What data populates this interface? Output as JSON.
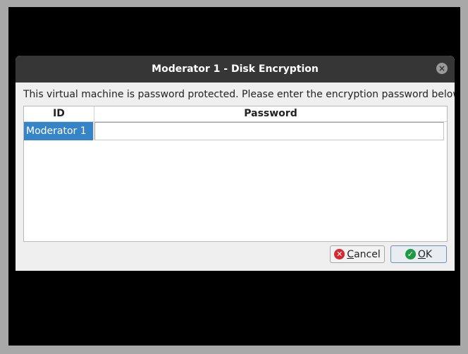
{
  "dialog": {
    "title": "Moderator 1 - Disk Encryption",
    "message": "This virtual machine is password protected. Please enter the encryption password below."
  },
  "table": {
    "columns": [
      "ID",
      "Password"
    ],
    "rows": [
      {
        "id": "Moderator 1",
        "password": ""
      }
    ]
  },
  "buttons": {
    "cancel": {
      "mnemonic": "C",
      "rest": "ancel",
      "icon": "cancel-icon"
    },
    "ok": {
      "mnemonic": "O",
      "rest": "K",
      "icon": "check-icon"
    }
  },
  "colors": {
    "titlebar": "#363636",
    "selection": "#3584c8",
    "cancel_icon": "#d8272d",
    "ok_icon": "#1f9a43"
  }
}
